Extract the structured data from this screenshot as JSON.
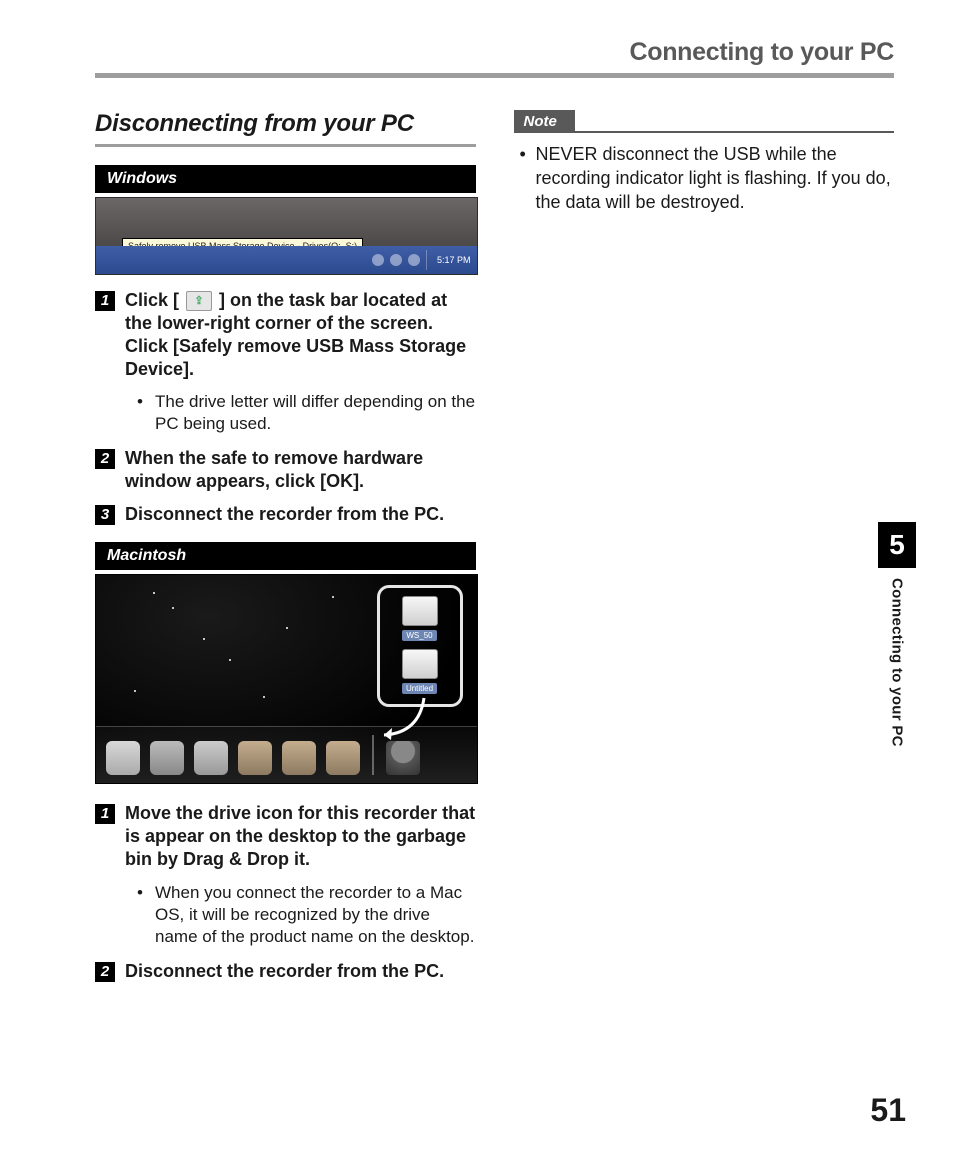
{
  "running_head": "Connecting to your PC",
  "section_title": "Disconnecting from your PC",
  "windows": {
    "label": "Windows",
    "screenshot": {
      "tooltip": "Safely remove USB Mass Storage Device - Drives(Q:, S:)",
      "clock": "5:17 PM"
    },
    "steps": [
      {
        "num": "1",
        "parts": {
          "a": "Click [ ",
          "b": " ] on the task bar located at the lower-right corner of the screen. Click [",
          "bold": "Safely remove USB Mass Storage Device",
          "c": "]."
        },
        "bullet": "The drive letter will differ depending on the PC being used."
      },
      {
        "num": "2",
        "parts": {
          "a": "When the safe to remove hardware window appears, click [",
          "bold": "OK",
          "c": "]."
        }
      },
      {
        "num": "3",
        "text": "Disconnect the recorder from the PC."
      }
    ]
  },
  "macintosh": {
    "label": "Macintosh",
    "screenshot": {
      "drive1": "WS_50",
      "drive2": "Untitled"
    },
    "steps": [
      {
        "num": "1",
        "text": "Move the drive icon for this recorder that is appear on the desktop to the garbage bin by Drag & Drop it.",
        "bullet": "When you connect the recorder to a Mac OS, it will be recognized by the drive name of the product name on the desktop."
      },
      {
        "num": "2",
        "text": "Disconnect the recorder from the PC."
      }
    ]
  },
  "note": {
    "label": "Note",
    "bullet": "NEVER disconnect the USB while the recording indicator light is flashing. If you do, the data will be destroyed."
  },
  "side_tab": {
    "num": "5",
    "text": "Connecting to your PC"
  },
  "page_number": "51"
}
